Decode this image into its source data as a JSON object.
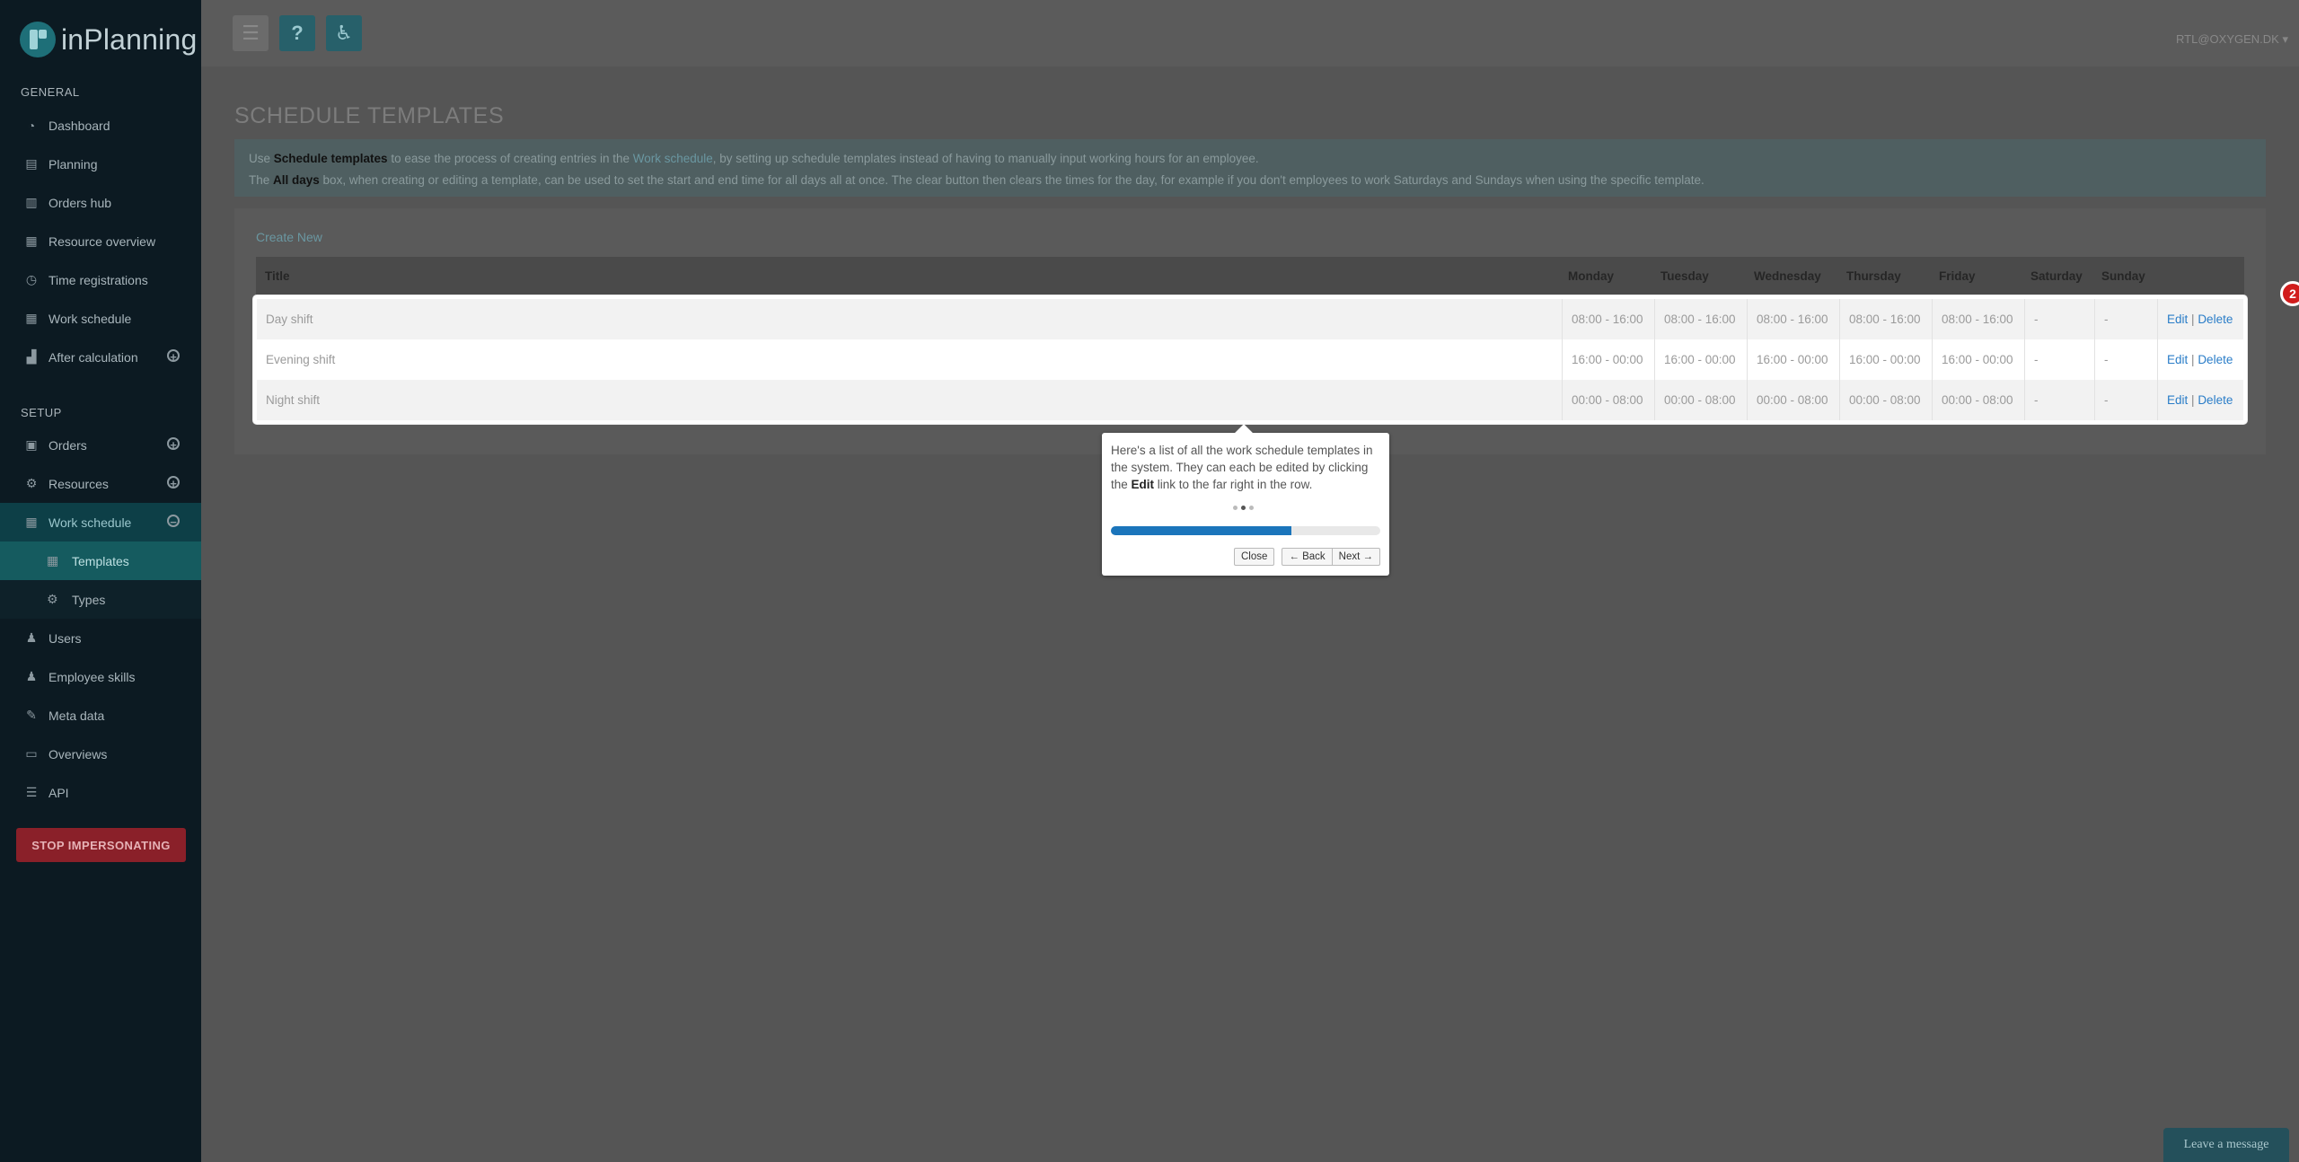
{
  "app": {
    "name": "inPlanning"
  },
  "topbar": {
    "user": "RTL@OXYGEN.DK ▾"
  },
  "sidebar": {
    "general_title": "GENERAL",
    "setup_title": "SETUP",
    "general_items": [
      {
        "label": "Dashboard",
        "icon": "dashboard-icon"
      },
      {
        "label": "Planning",
        "icon": "map-icon"
      },
      {
        "label": "Orders hub",
        "icon": "columns-icon"
      },
      {
        "label": "Resource overview",
        "icon": "clipboard-icon"
      },
      {
        "label": "Time registrations",
        "icon": "clock-icon"
      },
      {
        "label": "Work schedule",
        "icon": "calendar-icon"
      },
      {
        "label": "After calculation",
        "icon": "chart-icon"
      }
    ],
    "setup_items": [
      {
        "label": "Orders",
        "icon": "box-icon"
      },
      {
        "label": "Resources",
        "icon": "cogs-icon"
      },
      {
        "label": "Work schedule",
        "icon": "calendar-icon"
      },
      {
        "label": "Templates",
        "icon": "calendar-icon"
      },
      {
        "label": "Types",
        "icon": "cogs-icon"
      },
      {
        "label": "Users",
        "icon": "users-icon"
      },
      {
        "label": "Employee skills",
        "icon": "user-skills-icon"
      },
      {
        "label": "Meta data",
        "icon": "pencil-icon"
      },
      {
        "label": "Overviews",
        "icon": "inbox-icon"
      },
      {
        "label": "API",
        "icon": "list-icon"
      }
    ],
    "stop_button": "STOP IMPERSONATING"
  },
  "page": {
    "title": "SCHEDULE TEMPLATES",
    "info_line1_pre": "Use ",
    "info_line1_bold": "Schedule templates",
    "info_line1_mid": " to ease the process of creating entries in the ",
    "info_line1_link": "Work schedule",
    "info_line1_post": ", by setting up schedule templates instead of having to manually input working hours for an employee.",
    "info_line2_pre": "The ",
    "info_line2_bold": "All days",
    "info_line2_post": " box, when creating or editing a template, can be used to set the start and end time for all days all at once. The clear button then clears the times for the day, for example if you don't employees to work Saturdays and Sundays when using the specific template.",
    "create_new": "Create New"
  },
  "table": {
    "headers": [
      "Title",
      "Monday",
      "Tuesday",
      "Wednesday",
      "Thursday",
      "Friday",
      "Saturday",
      "Sunday"
    ],
    "rows": [
      {
        "title": "Day shift",
        "days": [
          "08:00 - 16:00",
          "08:00 - 16:00",
          "08:00 - 16:00",
          "08:00 - 16:00",
          "08:00 - 16:00",
          "-",
          "-"
        ]
      },
      {
        "title": "Evening shift",
        "days": [
          "16:00 - 00:00",
          "16:00 - 00:00",
          "16:00 - 00:00",
          "16:00 - 00:00",
          "16:00 - 00:00",
          "-",
          "-"
        ]
      },
      {
        "title": "Night shift",
        "days": [
          "00:00 - 08:00",
          "00:00 - 08:00",
          "00:00 - 08:00",
          "00:00 - 08:00",
          "00:00 - 08:00",
          "-",
          "-"
        ]
      }
    ],
    "edit_label": "Edit",
    "delete_label": "Delete",
    "separator": "|"
  },
  "tour": {
    "step_badge": "2",
    "text_pre": "Here's a list of all the work schedule templates in the system. They can each be edited by clicking the ",
    "text_bold": "Edit",
    "text_post": " link to the far right in the row.",
    "progress": 0.67,
    "close_label": "Close",
    "back_label": "← Back",
    "next_label": "Next →"
  },
  "chat": {
    "label": "Leave a message"
  }
}
